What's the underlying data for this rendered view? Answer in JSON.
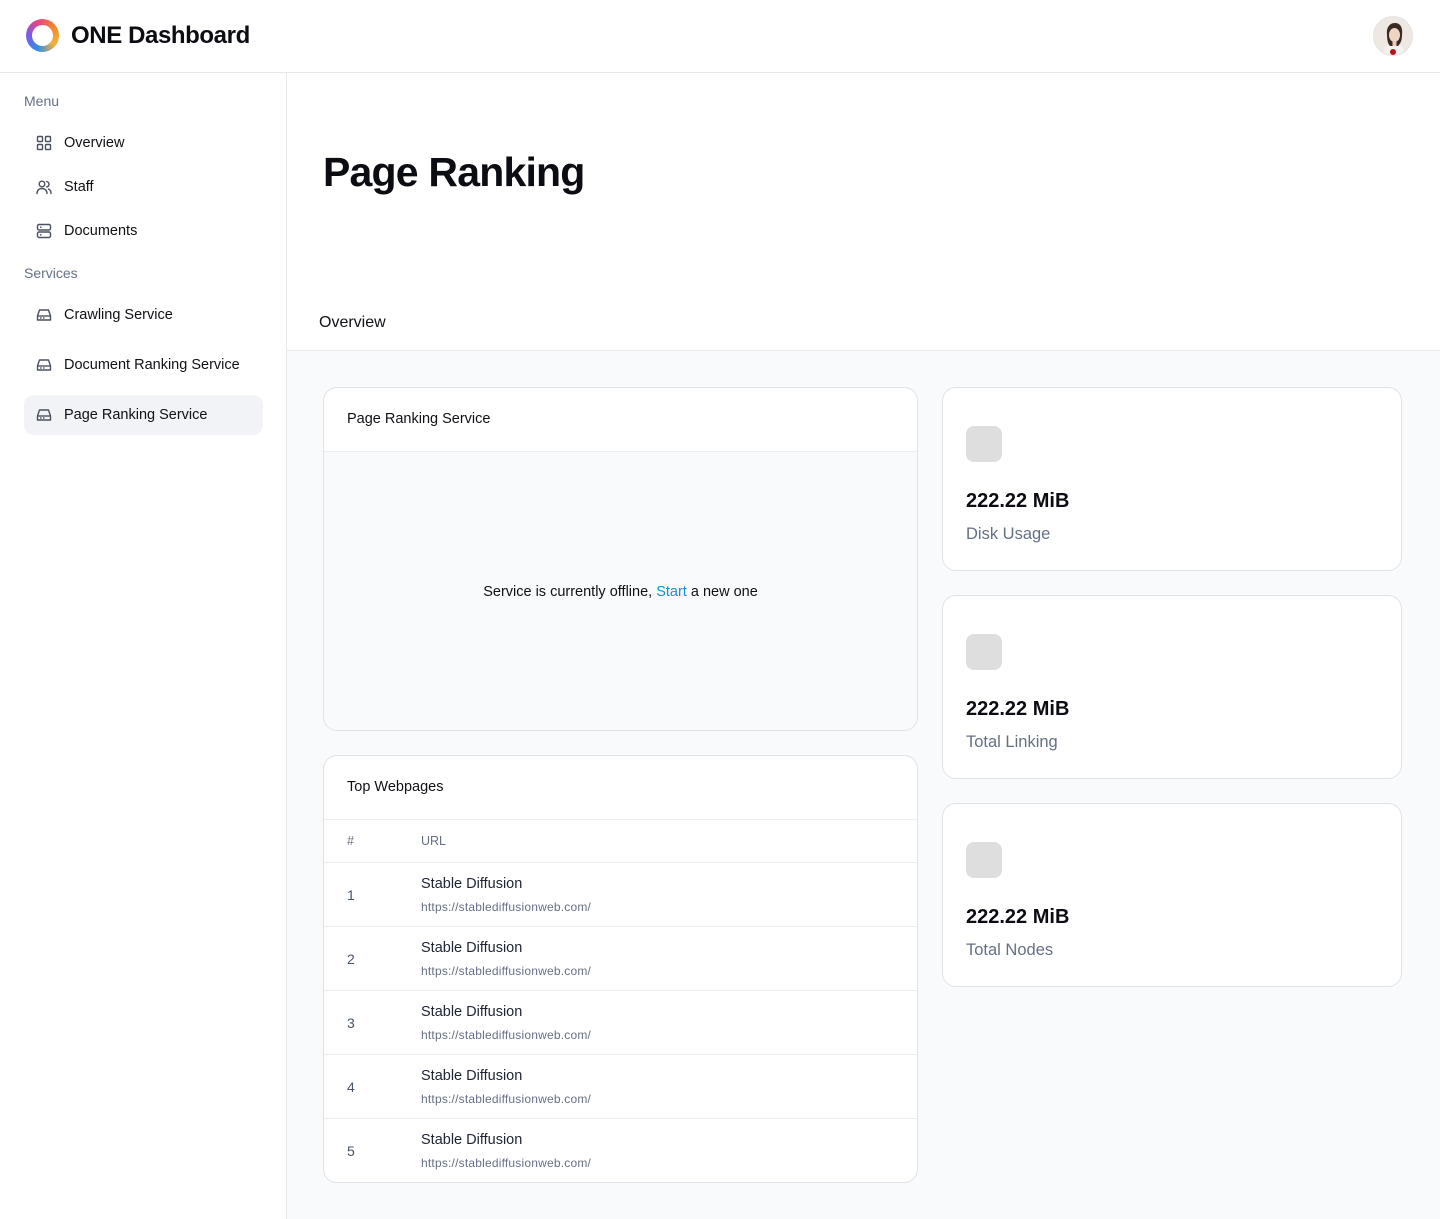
{
  "header": {
    "app_title": "ONE Dashboard",
    "logo_icon": "ring-logo-icon",
    "avatar_icon": "user-avatar"
  },
  "sidebar": {
    "sections": [
      {
        "title": "Menu",
        "items": [
          {
            "label": "Overview",
            "icon": "grid-icon"
          },
          {
            "label": "Staff",
            "icon": "users-icon"
          },
          {
            "label": "Documents",
            "icon": "server-icon"
          }
        ]
      },
      {
        "title": "Services",
        "items": [
          {
            "label": "Crawling Service",
            "icon": "drive-icon"
          },
          {
            "label": "Document Ranking Service",
            "icon": "drive-icon"
          },
          {
            "label": "Page Ranking Service",
            "icon": "drive-icon",
            "active": true
          }
        ]
      }
    ]
  },
  "page": {
    "title": "Page Ranking",
    "tabs": [
      "Overview"
    ]
  },
  "service_card": {
    "title": "Page Ranking Service",
    "status_text_before": "Service is currently offline, ",
    "link_text": "Start",
    "status_text_after": " a new one",
    "link_color": "#1a8fc9"
  },
  "table_card": {
    "title": "Top Webpages",
    "columns": [
      "#",
      "URL"
    ],
    "rows": [
      {
        "rank": "1",
        "name": "Stable Diffusion",
        "url": "https://stablediffusionweb.com/"
      },
      {
        "rank": "2",
        "name": "Stable Diffusion",
        "url": "https://stablediffusionweb.com/"
      },
      {
        "rank": "3",
        "name": "Stable Diffusion",
        "url": "https://stablediffusionweb.com/"
      },
      {
        "rank": "4",
        "name": "Stable Diffusion",
        "url": "https://stablediffusionweb.com/"
      },
      {
        "rank": "5",
        "name": "Stable Diffusion",
        "url": "https://stablediffusionweb.com/"
      }
    ]
  },
  "stats": [
    {
      "value": "222.22 MiB",
      "label": "Disk Usage"
    },
    {
      "value": "222.22 MiB",
      "label": "Total Linking"
    },
    {
      "value": "222.22 MiB",
      "label": "Total Nodes"
    }
  ]
}
